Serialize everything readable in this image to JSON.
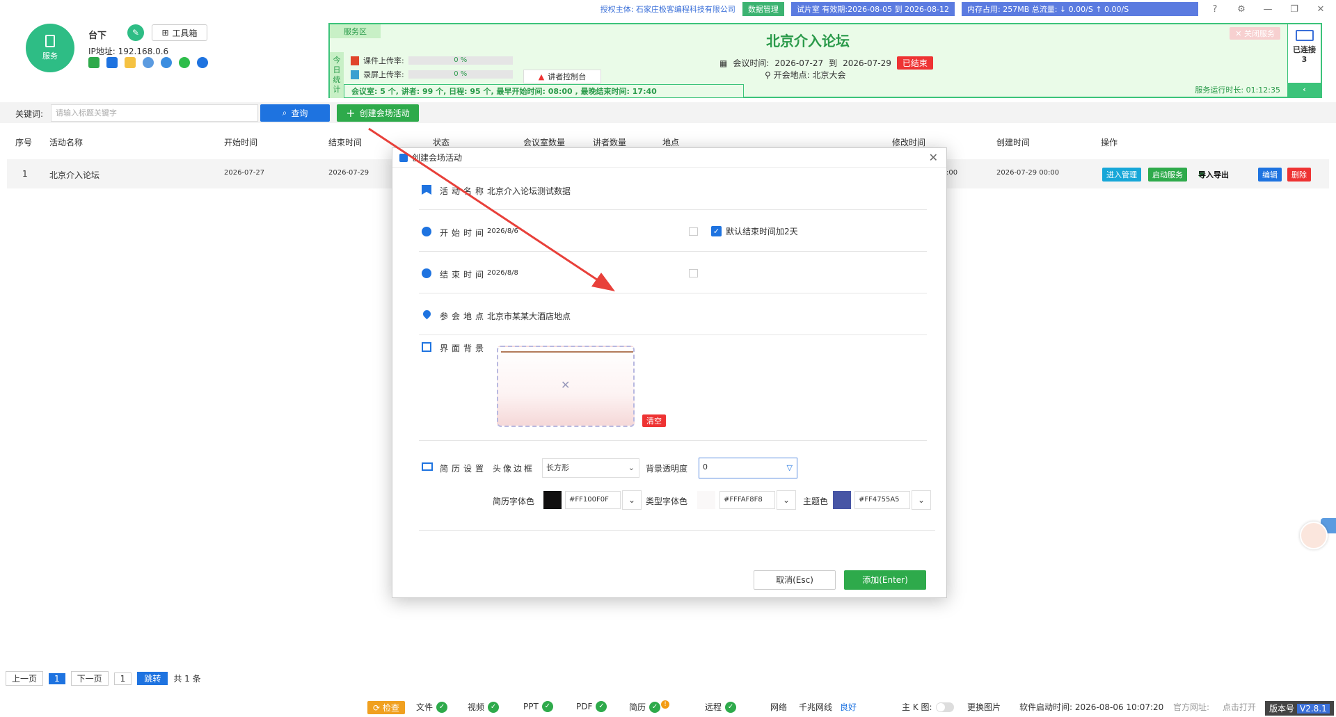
{
  "sysbar": {
    "auth": "授权主体: 石家庄极客编程科技有限公司",
    "data_mgr": "数据管理",
    "trial": "试片室 有效期:2026-08-05 到 2026-08-12",
    "mem": "内存占用: 257MB    总流量: ↓ 0.00/S    ↑ 0.00/S"
  },
  "header": {
    "service_label": "服务",
    "host_name": "台下",
    "toolbox": "工具箱",
    "ip": "IP地址: 192.168.0.6"
  },
  "service": {
    "zone": "服务区",
    "stat_label": [
      "今",
      "日",
      "统",
      "计"
    ],
    "courseware_label": "课件上传率:",
    "courseware_rate": "0 %",
    "screen_label": "录屏上传率:",
    "screen_rate": "0 %",
    "speaker_console": "讲者控制台",
    "stats": "会议室:  5 个,  讲者:  99 个,  日程:  95 个,  最早开始时间:  08:00 ,   最晚结束时间:  17:40",
    "title": "北京介入论坛",
    "time_label": "会议时间:",
    "time_start": "2026-07-27",
    "time_to": "到",
    "time_end": "2026-07-29",
    "ended": "已结束",
    "location": "开会地点:  北京大会",
    "close_service": "✕ 关闭服务",
    "runtime": "服务运行时长: 01:12:35",
    "connected_label": "已连接",
    "connected_count": "3"
  },
  "search": {
    "keyword_label": "关键词:",
    "placeholder": "请输入标题关键字",
    "query": "查询",
    "create": "创建会场活动"
  },
  "table": {
    "headers": [
      "序号",
      "活动名称",
      "开始时间",
      "结束时间",
      "状态",
      "会议室数量",
      "讲者数量",
      "地点",
      "修改时间",
      "创建时间",
      "操作"
    ],
    "row": {
      "index": "1",
      "name": "北京介入论坛",
      "start": "2026-07-27",
      "end": "2026-07-29",
      "modified": ":00",
      "created": "2026-07-29 00:00",
      "op_manage": "进入管理",
      "op_start": "启动服务",
      "op_import": "导入导出",
      "op_edit": "编辑",
      "op_delete": "删除"
    }
  },
  "pager": {
    "prev": "上一页",
    "current": "1",
    "next": "下一页",
    "page_input": "1",
    "jump": "跳转",
    "total": "共 1 条"
  },
  "footer": {
    "check": "检查",
    "file": "文件",
    "video": "视频",
    "ppt": "PPT",
    "pdf": "PDF",
    "resume": "简历",
    "remote": "远程",
    "network": "网络",
    "gigabit": "千兆网线",
    "good": "良好",
    "kmap": "主 K 图:",
    "change_img": "更换图片",
    "boot_time": "软件启动时间: 2026-08-06 10:07:20",
    "official": "官方网址:",
    "click_open": "点击打开",
    "version_label": "版本号",
    "version": "V2.8.1"
  },
  "dialog": {
    "title": "创建会场活动",
    "name_label": "活动名称",
    "name_value": "北京介入论坛测试数据",
    "start_label": "开始时间",
    "start_value": "2026/8/6",
    "default_end": "默认结束时间加2天",
    "end_label": "结束时间",
    "end_value": "2026/8/8",
    "loc_label": "参会地点",
    "loc_value": "北京市某某大酒店地点",
    "bg_label": "界面背景",
    "clear": "清空",
    "resume_label": "简历设置",
    "avatar_border_label": "头像边框",
    "avatar_border_value": "长方形",
    "bg_opacity_label": "背景透明度",
    "bg_opacity_value": "0",
    "resume_font_label": "简历字体色",
    "resume_font_hex": "#FF100F0F",
    "type_font_label": "类型字体色",
    "type_font_hex": "#FFFAF8F8",
    "theme_label": "主题色",
    "theme_hex": "#FF4755A5",
    "cancel": "取消(Esc)",
    "add": "添加(Enter)"
  },
  "colors": {
    "green": "#2eaa4b",
    "blue": "#1e73e0",
    "red": "#e33333",
    "resume_font": "#100F0F",
    "type_font": "#FAF8F8",
    "theme": "#4755A5"
  }
}
